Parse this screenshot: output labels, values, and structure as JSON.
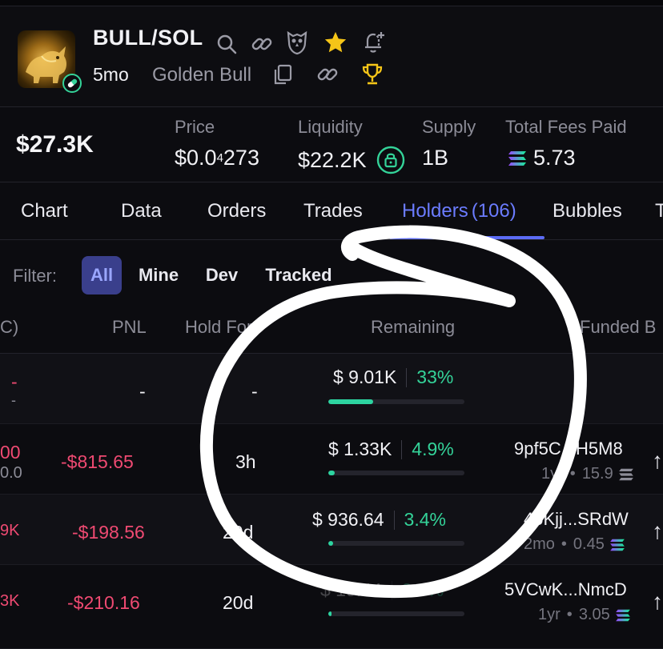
{
  "token": {
    "pair": "BULL/SOL",
    "age": "5mo",
    "name": "Golden Bull"
  },
  "stats": {
    "market_cap": "$27.3K",
    "price_label": "Price",
    "price_prefix": "$0.0",
    "price_sub": "4",
    "price_suffix": "273",
    "liquidity_label": "Liquidity",
    "liquidity_value": "$22.2K",
    "supply_label": "Supply",
    "supply_value": "1B",
    "fees_label": "Total Fees Paid",
    "fees_value": "5.73"
  },
  "tabs": [
    {
      "label": "Chart"
    },
    {
      "label": "Data"
    },
    {
      "label": "Orders"
    },
    {
      "label": "Trades"
    },
    {
      "label": "Holders",
      "count": "(106)",
      "active": true
    },
    {
      "label": "Bubbles"
    },
    {
      "label": "T"
    }
  ],
  "filter": {
    "label": "Filter:",
    "options": [
      "All",
      "Mine",
      "Dev",
      "Tracked"
    ],
    "selected": "All"
  },
  "columns": {
    "c0": "C)",
    "pnl": "PNL",
    "hold": "Hold For",
    "remaining": "Remaining",
    "funded": "Funded B"
  },
  "rows": [
    {
      "c0_top": "-",
      "c0_bottom": "-",
      "pnl": "-",
      "hold": "-",
      "remain_usd": "$ 9.01K",
      "remain_pct": "33%",
      "remain_frac": 0.33,
      "addr": "",
      "sub_age": "",
      "sub_amt": ""
    },
    {
      "c0_top": "00",
      "c0_bottom": "0.0",
      "pnl": "-$815.65",
      "hold": "3h",
      "remain_usd": "$ 1.33K",
      "remain_pct": "4.9%",
      "remain_frac": 0.049,
      "addr": "9pf5C...H5M8",
      "sub_age": "1yr",
      "sub_amt": "15.9"
    },
    {
      "c0_top": "9K",
      "c0_bottom": "",
      "pnl": "-$198.56",
      "hold": "20d",
      "remain_usd": "$ 936.64",
      "remain_pct": "3.4%",
      "remain_frac": 0.034,
      "addr": "4oKjj...SRdW",
      "sub_age": "2mo",
      "sub_amt": "0.45"
    },
    {
      "c0_top": "3K",
      "c0_bottom": "",
      "pnl": "-$210.16",
      "hold": "20d",
      "remain_usd": "$ 19.44",
      "remain_pct": "2.0%",
      "remain_frac": 0.02,
      "addr": "5VCwK...NmcD",
      "sub_age": "1yr",
      "sub_amt": "3.05"
    }
  ],
  "colors": {
    "accent": "#5c6cf5",
    "positive": "#34d399",
    "negative": "#ef4a72",
    "annotation": "#ffffff"
  },
  "icons": [
    "search-icon",
    "link-icon",
    "owl-icon",
    "star-icon",
    "bell-plus-icon",
    "copy-icon",
    "link-icon",
    "trophy-icon",
    "lock-icon",
    "solana-icon",
    "arrow-up-icon",
    "pill-icon"
  ]
}
